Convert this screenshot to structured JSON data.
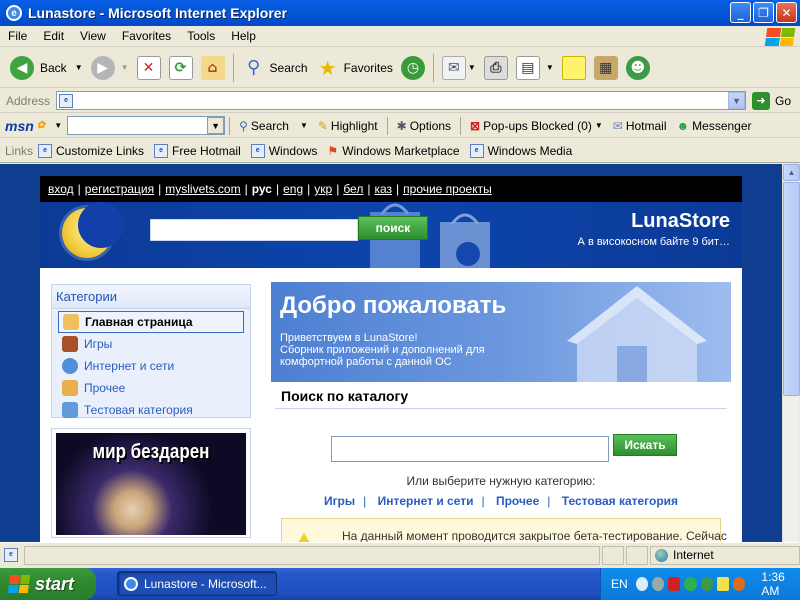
{
  "window": {
    "title": "Lunastore - Microsoft Internet Explorer"
  },
  "menu": [
    "File",
    "Edit",
    "View",
    "Favorites",
    "Tools",
    "Help"
  ],
  "toolbar": {
    "back": "Back",
    "search": "Search",
    "favorites": "Favorites"
  },
  "address": {
    "label": "Address",
    "value": "",
    "go": "Go"
  },
  "msn": {
    "logo": "msn",
    "search": "Search",
    "highlight": "Highlight",
    "options": "Options",
    "popups": "Pop-ups Blocked (0)",
    "hotmail": "Hotmail",
    "messenger": "Messenger"
  },
  "links": {
    "label": "Links",
    "items": [
      "Customize Links",
      "Free Hotmail",
      "Windows",
      "Windows Marketplace",
      "Windows Media"
    ]
  },
  "site": {
    "toplinks": {
      "login": "вход",
      "register": "регистрация",
      "myslivets": "myslivets.com",
      "rus": "рус",
      "eng": "eng",
      "ukr": "укр",
      "bel": "бел",
      "kaz": "каз",
      "other": "прочие проекты",
      "sep": "|"
    },
    "search_button": "поиск",
    "brand": "LunaStore",
    "tagline": "А в високосном байте 9 бит…",
    "categories": {
      "title": "Категории",
      "items": [
        "Главная страница",
        "Игры",
        "Интернет и сети",
        "Прочее",
        "Тестовая категория"
      ]
    },
    "promo_caption": "мир бездарен",
    "welcome": {
      "title": "Добро пожаловать",
      "line1": "Приветствуем в LunaStore!",
      "line2": "Сборник приложений и дополнений для",
      "line3": "комфортной работы с данной ОС"
    },
    "catalog": {
      "title": "Поиск по каталогу",
      "button": "Искать",
      "or_text": "Или выберите нужную категорию:",
      "links": [
        "Игры",
        "Интернет и сети",
        "Прочее",
        "Тестовая категория"
      ],
      "notice": "На данный момент проводится закрытое бета-тестирование. Сейчас"
    }
  },
  "status": {
    "zone": "Internet"
  },
  "taskbar": {
    "start": "start",
    "task": "Lunastore - Microsoft...",
    "lang": "EN",
    "time": "1:36 AM"
  },
  "colors": {
    "titlebar": "#0458d6",
    "site_header": "#0b3a96",
    "accent_green": "#2e8f2e",
    "link": "#2a5cbf"
  }
}
